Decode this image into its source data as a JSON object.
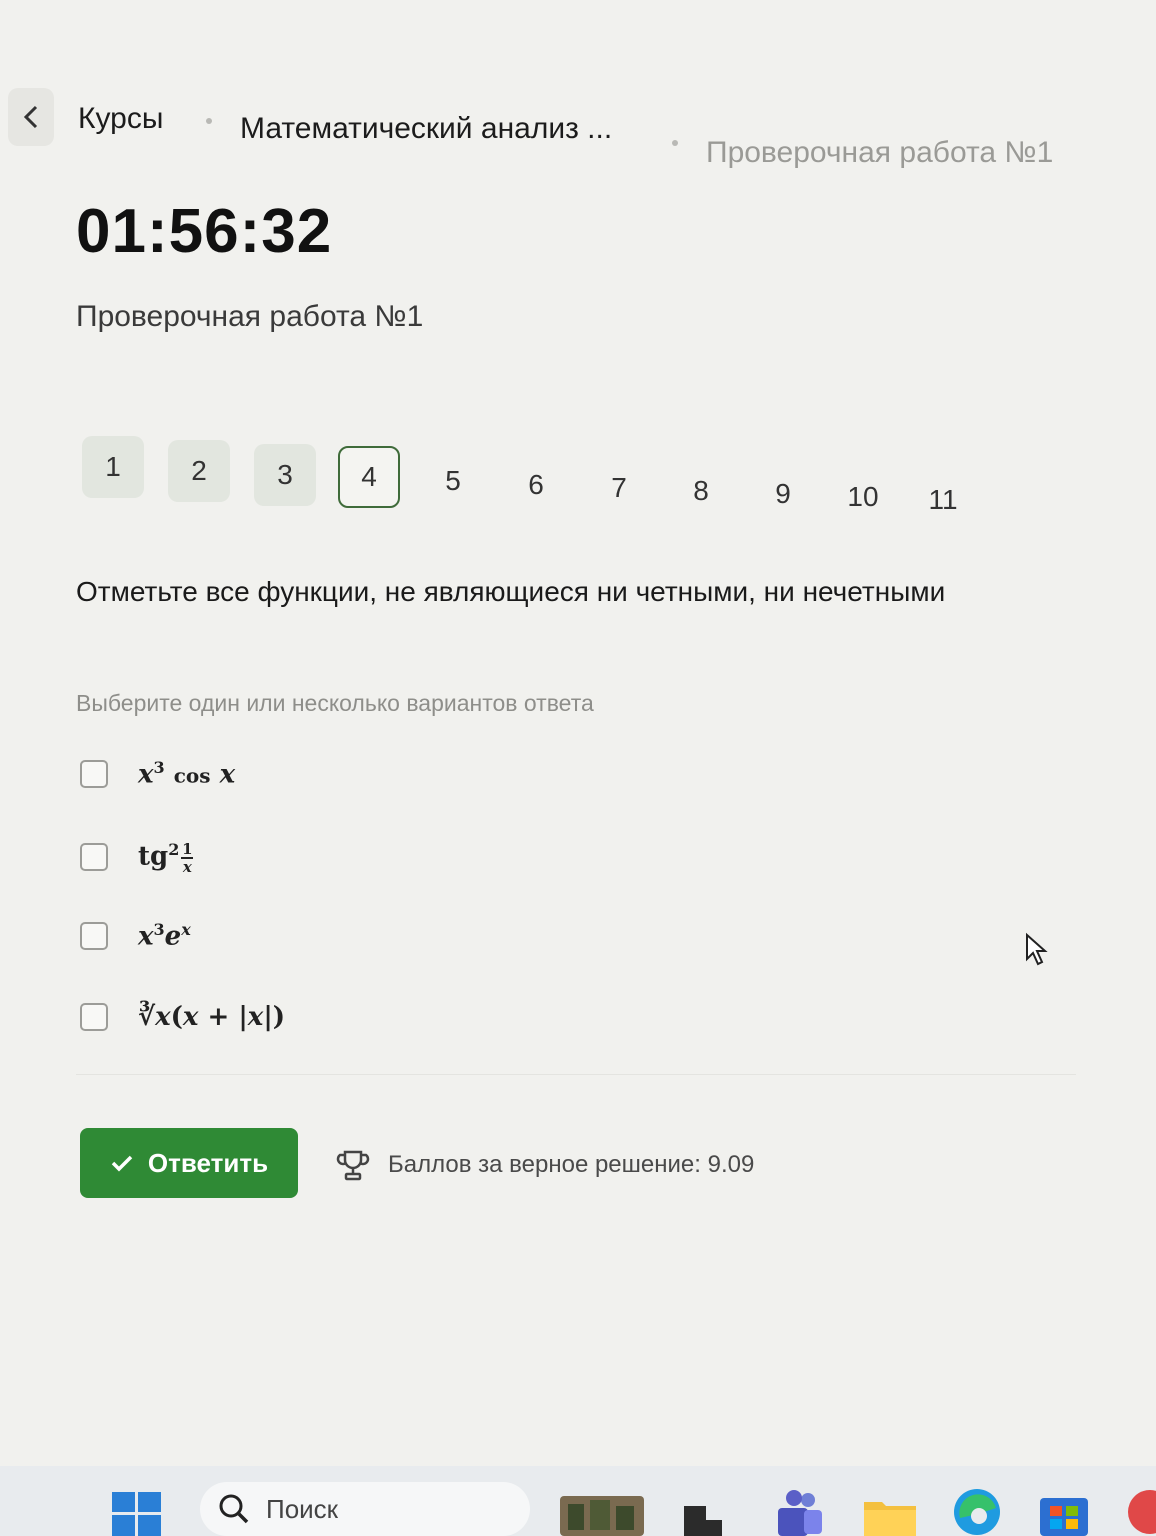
{
  "breadcrumb": {
    "items": [
      "Курсы",
      "Математический анализ ...",
      "Проверочная работа №1"
    ]
  },
  "timer": "01:56:32",
  "test_title": "Проверочная работа №1",
  "question_nav": {
    "items": [
      "1",
      "2",
      "3",
      "4",
      "5",
      "6",
      "7",
      "8",
      "9",
      "10",
      "11"
    ],
    "active": "4",
    "answered": [
      "1",
      "2",
      "3"
    ]
  },
  "question": {
    "text": "Отметьте все функции, не являющиеся ни четными, ни нечетными",
    "hint": "Выберите один или несколько вариантов ответа",
    "options": [
      {
        "label": "x³ cos x",
        "checked": false
      },
      {
        "label": "tg² 1/x",
        "checked": false
      },
      {
        "label": "x³eˣ",
        "checked": false
      },
      {
        "label": "∛x(x + |x|)",
        "checked": false
      }
    ]
  },
  "actions": {
    "submit_label": "Ответить",
    "score_text": "Баллов за верное решение: 9.09"
  },
  "taskbar": {
    "search_placeholder": "Поиск"
  },
  "colors": {
    "accent": "#2f8a35",
    "active_border": "#3f6b3a"
  }
}
